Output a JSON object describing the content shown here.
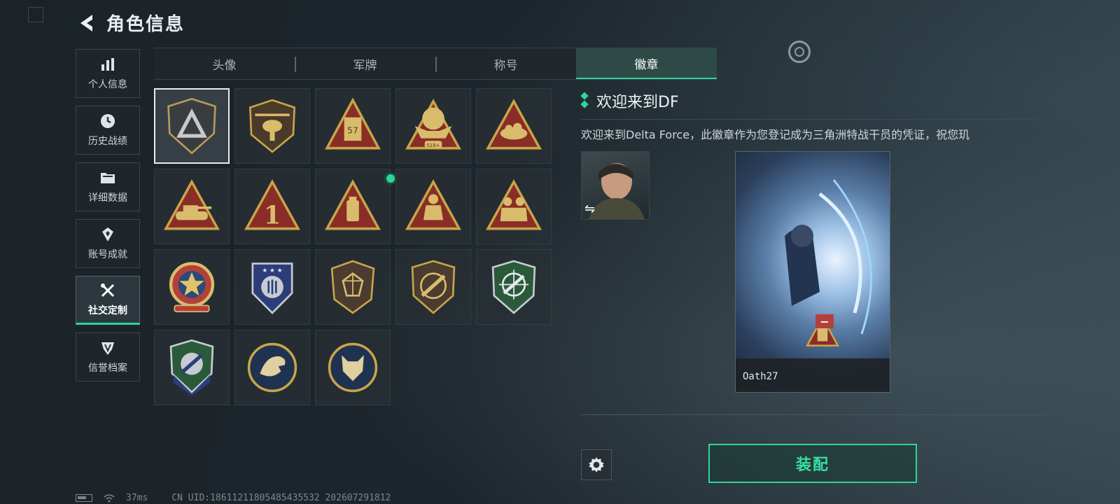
{
  "header": {
    "title": "角色信息"
  },
  "sidebar": {
    "items": [
      {
        "label": "个人信息",
        "icon": "bar-chart-icon"
      },
      {
        "label": "历史战绩",
        "icon": "clock-icon"
      },
      {
        "label": "详细数据",
        "icon": "folder-icon"
      },
      {
        "label": "账号成就",
        "icon": "achievement-icon"
      },
      {
        "label": "社交定制",
        "icon": "tools-icon",
        "active": true
      },
      {
        "label": "信誉档案",
        "icon": "shield-icon"
      }
    ]
  },
  "tabs": [
    {
      "label": "头像"
    },
    {
      "label": "军牌"
    },
    {
      "label": "称号"
    },
    {
      "label": "徽章",
      "active": true
    }
  ],
  "badges": [
    {
      "icon": "delta-shield-badge-icon",
      "selected": true
    },
    {
      "icon": "helicopter-badge-icon"
    },
    {
      "icon": "card-57-badge-icon",
      "text": "57"
    },
    {
      "icon": "explosion-s18-badge-icon",
      "text": "S18+"
    },
    {
      "icon": "nest-badge-icon"
    },
    {
      "icon": "tank-badge-icon"
    },
    {
      "icon": "number-one-badge-icon",
      "text": "1"
    },
    {
      "icon": "usb-badge-icon",
      "new": true
    },
    {
      "icon": "crouch-soldier-badge-icon"
    },
    {
      "icon": "squad-badge-icon"
    },
    {
      "icon": "star-eagle-emblem-icon"
    },
    {
      "icon": "blue-stars-emblem-icon"
    },
    {
      "icon": "gem-shield-emblem-icon"
    },
    {
      "icon": "rifle-shield-emblem-icon"
    },
    {
      "icon": "green-crosshair-emblem-icon"
    },
    {
      "icon": "blue-knife-emblem-icon"
    },
    {
      "icon": "eagle-head-emblem-icon"
    },
    {
      "icon": "wolf-head-emblem-icon"
    }
  ],
  "detail": {
    "badge_title": "欢迎来到DF",
    "badge_desc": "欢迎来到Delta Force，此徽章作为您登记成为三角洲特战干员的凭证，祝您玑"
  },
  "card": {
    "player_name": "Oath27"
  },
  "actions": {
    "equip_label": "装配"
  },
  "status": {
    "ping": "37ms",
    "uid": "CN UID:1861121180548543553​2 202607291812"
  },
  "colors": {
    "accent": "#2fd49a",
    "gold": "#c9a44a",
    "badge_red": "#8a2d26"
  }
}
